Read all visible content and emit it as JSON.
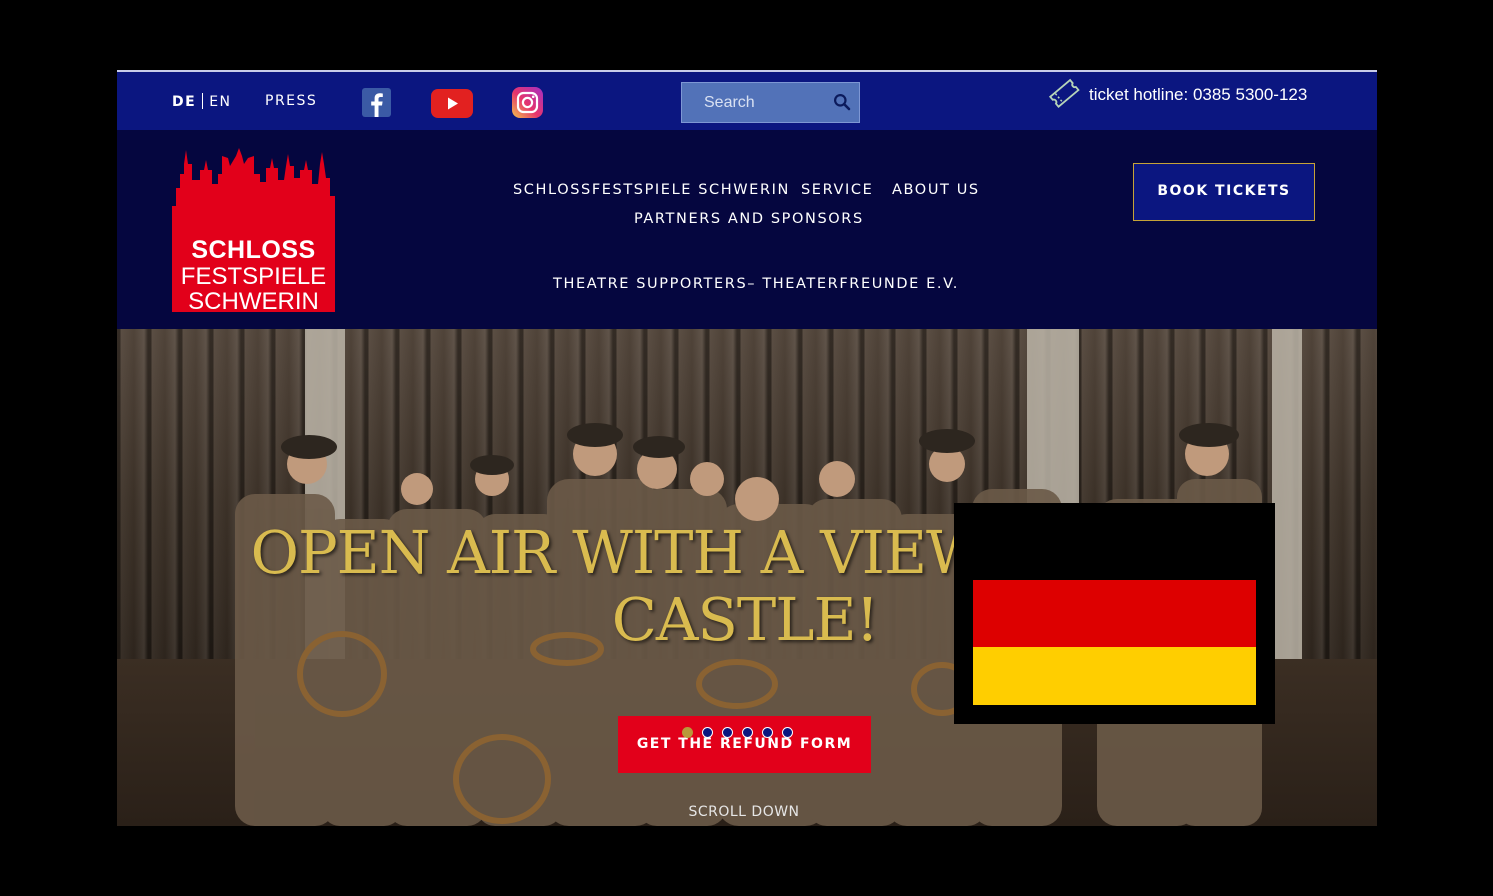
{
  "topbar": {
    "lang_de": "DE",
    "lang_en": "EN",
    "press": "PRESS",
    "social": [
      "facebook-icon",
      "youtube-icon",
      "instagram-icon"
    ],
    "search_placeholder": "Search",
    "hotline": "ticket hotline: 0385 5300-123"
  },
  "logo": {
    "line1": "SCHLOSS",
    "line2": "FESTSPIELE",
    "line3": "SCHWERIN",
    "color": "#e2001a"
  },
  "nav": {
    "items": [
      "SCHLOSSFESTSPIELE SCHWERIN",
      "SERVICE",
      "ABOUT US",
      "PARTNERS AND SPONSORS",
      "THEATRE SUPPORTERS– THEATERFREUNDE E.V."
    ]
  },
  "cta": {
    "book": "BOOK TICKETS",
    "accent": "#c6a338"
  },
  "hero": {
    "headline": "OPEN AIR WITH A VIEW OF THE CASTLE!",
    "refund": "GET THE REFUND FORM",
    "slides_total": 6,
    "slide_active": 1,
    "scroll": "SCROLL DOWN"
  },
  "overlay": {
    "flag": "german-flag-icon",
    "colors": [
      "#000000",
      "#dd0000",
      "#ffce00"
    ]
  }
}
